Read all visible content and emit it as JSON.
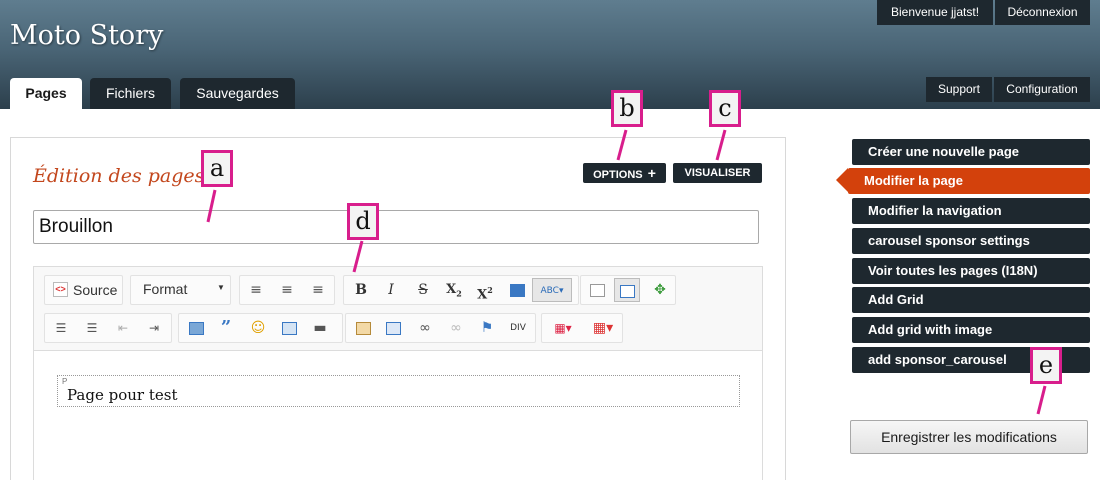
{
  "header": {
    "site_title": "Moto Story",
    "welcome": "Bienvenue jjatst!",
    "logout": "Déconnexion",
    "support": "Support",
    "configuration": "Configuration"
  },
  "tabs": [
    {
      "label": "Pages",
      "active": true
    },
    {
      "label": "Fichiers",
      "active": false
    },
    {
      "label": "Sauvegardes",
      "active": false
    }
  ],
  "main": {
    "title": "Édition des pages",
    "options_label": "OPTIONS",
    "options_icon": "+",
    "preview_label": "VISUALISER",
    "page_name_value": "Brouillon"
  },
  "editor": {
    "source_label": "Source",
    "format_label": "Format",
    "block_tag": "P",
    "content": "Page pour test",
    "toolbar_icons": [
      "source-icon",
      "format-dropdown",
      "align-left-icon",
      "align-center-icon",
      "align-right-icon",
      "bold-icon",
      "italic-icon",
      "strikethrough-icon",
      "subscript-icon",
      "superscript-icon",
      "html-icon",
      "spellcheck-icon",
      "preview-icon",
      "show-blocks-icon",
      "maximize-icon",
      "numbered-list-icon",
      "bulleted-list-icon",
      "outdent-icon",
      "indent-icon",
      "image-icon",
      "blockquote-icon",
      "smiley-icon",
      "table-icon",
      "horizontal-rule-icon",
      "template-icon",
      "paste-word-icon",
      "link-icon",
      "unlink-icon",
      "anchor-icon",
      "div-icon",
      "colors-icon",
      "table-dropdown-icon"
    ]
  },
  "sidebar": {
    "items": [
      {
        "label": "Créer une nouvelle page",
        "active": false
      },
      {
        "label": "Modifier la page",
        "active": true
      },
      {
        "label": "Modifier la navigation",
        "active": false
      },
      {
        "label": "carousel sponsor settings",
        "active": false
      },
      {
        "label": "Voir toutes les pages (I18N)",
        "active": false
      },
      {
        "label": "Add Grid",
        "active": false
      },
      {
        "label": "Add grid with image",
        "active": false
      },
      {
        "label": "add sponsor_carousel",
        "active": false
      }
    ],
    "save_label": "Enregistrer les modifications"
  },
  "callouts": {
    "a": "a",
    "b": "b",
    "c": "c",
    "d": "d",
    "e": "e"
  },
  "colors": {
    "accent": "#d3410c",
    "title_accent": "#c3471d",
    "dark_button": "#1e282f",
    "callout_border": "#d81e8c"
  }
}
